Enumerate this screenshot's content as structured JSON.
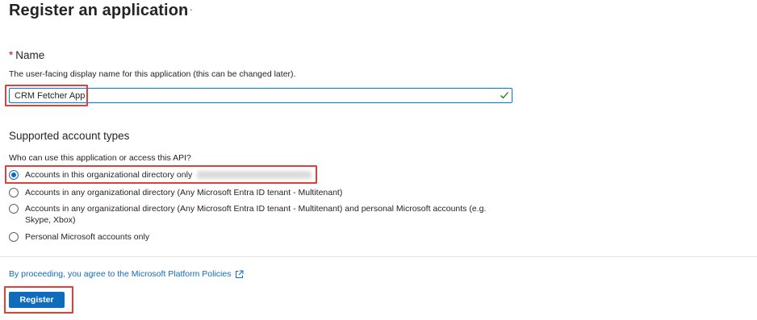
{
  "page": {
    "title": "Register an application",
    "more_label": "···"
  },
  "name_section": {
    "label": "Name",
    "required_marker": "*",
    "description": "The user-facing display name for this application (this can be changed later).",
    "input_value": "CRM Fetcher App",
    "valid_icon": "checkmark-icon"
  },
  "account_types": {
    "heading": "Supported account types",
    "question": "Who can use this application or access this API?",
    "options": [
      {
        "label": "Accounts in this organizational directory only",
        "selected": true
      },
      {
        "label": "Accounts in any organizational directory (Any Microsoft Entra ID tenant - Multitenant)",
        "selected": false
      },
      {
        "label": "Accounts in any organizational directory (Any Microsoft Entra ID tenant - Multitenant) and personal Microsoft accounts (e.g. Skype, Xbox)",
        "selected": false
      },
      {
        "label": "Personal Microsoft accounts only",
        "selected": false
      }
    ]
  },
  "footer": {
    "policy_text": "By proceeding, you agree to the Microsoft Platform Policies",
    "policy_icon": "external-link-icon",
    "register_label": "Register"
  },
  "colors": {
    "accent": "#0f6cbd",
    "highlight": "#e0403c",
    "valid_check": "#107c10"
  }
}
